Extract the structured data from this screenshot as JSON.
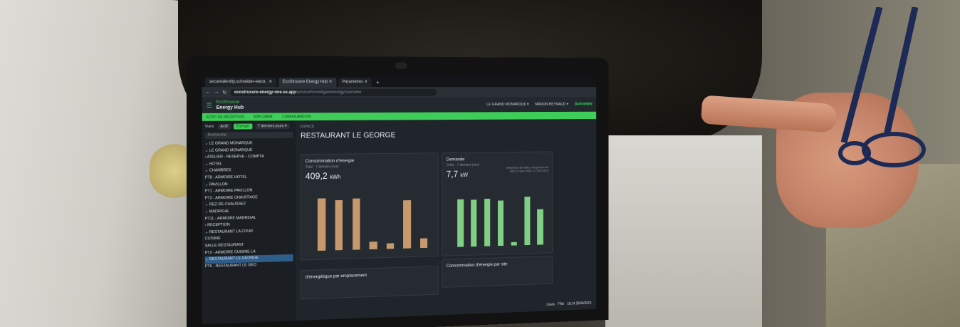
{
  "browser": {
    "tabs": [
      {
        "label": "secureidentity.schneider-electr.. ✕"
      },
      {
        "label": "EcoStruxure Energy Hub  ✕"
      },
      {
        "label": "Paramètres  ✕"
      }
    ],
    "new_tab": "+",
    "url_host": "ecostruxure-energy-one.se.app",
    "url_path": "/advisor/investigate/energy/overview"
  },
  "app": {
    "brand_top": "EcoStruxure",
    "brand_name": "Energy Hub",
    "site_selector": "LE GRAND MONARQUE ▾",
    "user": "MANON REYNAUD ▾",
    "logo": "Schneider"
  },
  "nav": {
    "items": [
      "ECRIT DE RÉCEPTION",
      "EXPLORER",
      "CONFIGURATION"
    ]
  },
  "filters": {
    "view_label": "Vues:",
    "opt1": "Actif",
    "opt2": "Énergie",
    "period": "7 derniers jours ▾",
    "search_placeholder": "Recherche"
  },
  "tree": [
    "⌄ LE GRAND MONARQUE",
    "  ⌄ LE GRAND MONARQUE",
    "    › ATELIER - RESERVE - COMPTA",
    "    ⌄ HOTEL",
    "      ⌄ CHAMBRES",
    "          PT8 - ARMOIRE HOTEL",
    "      ⌄ PAVILLON",
    "          PT1 - ARMOIRE PAVILLON",
    "        PT3 - ARMOIRE CHAUFFAGE",
    "    ⌄ REZ-DE-CHAUSSEZ",
    "      ⌄ MADRIGAL",
    "          PT11 - ARMOIRE MADRIGAL",
    "      › RECEPTION",
    "      ⌄ RESTAURANT LA COUR",
    "          CUISINE",
    "          SALLE RESTAURANT",
    "          PT2 - ARMOIRE CUISINE LA",
    "      ⌄ RESTAURANT LE GEORGE",
    "          PT6 - RESTAURANT LE GEO"
  ],
  "main": {
    "crumb": "ESPACE",
    "title": "RESTAURANT LE GEORGE"
  },
  "cards": {
    "energy": {
      "title": "Consommation d'énergie",
      "sub": "Total · 7 derniers jours",
      "value": "409,2",
      "unit": "kWh",
      "bars": [
        0.94,
        0.9,
        0.93,
        0.14,
        0.1,
        0.88,
        0.18
      ],
      "color": "#c79a6e"
    },
    "demand": {
      "title": "Demande",
      "sub": "Crête · 7 derniers jours",
      "value": "7,7",
      "unit": "kW",
      "note": "Maximum de valeur moyenne sur plus 10 juin 2023, 17:00 (15 s)",
      "bars": [
        0.88,
        0.86,
        0.88,
        0.84,
        0.06,
        0.9,
        0.66
      ],
      "color": "#7fcf84"
    },
    "energy_site": {
      "title": "Consommation d'énergie par site"
    },
    "energy_loc": {
      "title": "d'énergétique par emplacement"
    }
  },
  "taskbar": {
    "lang": "FRA",
    "time": "18:14",
    "date": "29/06/2023",
    "weather": "Lluvia"
  }
}
